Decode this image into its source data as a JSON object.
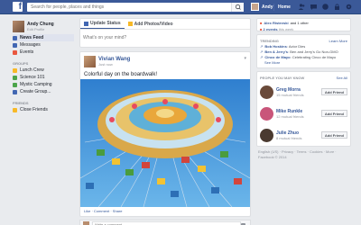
{
  "topbar": {
    "search_placeholder": "Search for people, places and things",
    "user_name": "Andy",
    "home_label": "Home"
  },
  "leftnav": {
    "profile_name": "Andy Chung",
    "edit_profile": "Edit Profile",
    "items": [
      {
        "label": "News Feed",
        "icon": "news-feed-icon",
        "color": "#4267b2"
      },
      {
        "label": "Messages",
        "icon": "messages-icon",
        "color": "#4267b2"
      },
      {
        "label": "Events",
        "icon": "events-icon",
        "color": "#e9573f"
      }
    ],
    "groups_header": "GROUPS",
    "groups": [
      {
        "label": "Lunch Crew",
        "icon": "group-icon",
        "color": "#f7b928"
      },
      {
        "label": "Science 101",
        "icon": "group-icon",
        "color": "#4ba44a"
      },
      {
        "label": "Mystic Camping",
        "icon": "group-icon",
        "color": "#4ba44a"
      },
      {
        "label": "Create Group...",
        "icon": "create-group-icon",
        "color": "#4267b2"
      }
    ],
    "friends_header": "FRIENDS",
    "friends": [
      {
        "label": "Close Friends",
        "icon": "close-friends-icon",
        "color": "#f7b928"
      }
    ]
  },
  "composer": {
    "tab_status": "Update Status",
    "tab_photo": "Add Photos/Video",
    "placeholder": "What's on your mind?"
  },
  "post": {
    "author": "Vivian Wang",
    "time": "Just now",
    "text": "Colorful day on the boardwalk!",
    "actions": "Like · Comment · Share",
    "comment_placeholder": "Write a comment..."
  },
  "right": {
    "birthday_name": "Alex Ristevski",
    "birthday_suffix": "and 1 other",
    "events_count": "2 events",
    "events_suffix": "this week",
    "trending_header": "TRENDING",
    "learn_more": "Learn More",
    "trends": [
      {
        "name": "Bob Hoskins",
        "text": "Actor Dies"
      },
      {
        "name": "Ben & Jerry's",
        "text": "Ben and Jerry's Go Non-GMO"
      },
      {
        "name": "Cinco de Mayo",
        "text": "Celebrating Cinco de Mayo"
      }
    ],
    "see_more": "See More",
    "pymk_header": "PEOPLE YOU MAY KNOW",
    "see_all": "See All",
    "people": [
      {
        "name": "Greg Morra",
        "mutual": "15 mutual friends",
        "color": "#6a4a3a"
      },
      {
        "name": "Mike Runkle",
        "mutual": "12 mutual friends",
        "color": "#c9557a"
      },
      {
        "name": "Julie Zhuo",
        "mutual": "8 mutual friends",
        "color": "#4a3a30"
      }
    ],
    "add_friend": "Add Friend",
    "footer": "English (US) · Privacy · Terms · Cookies · More · Facebook © 2014"
  }
}
